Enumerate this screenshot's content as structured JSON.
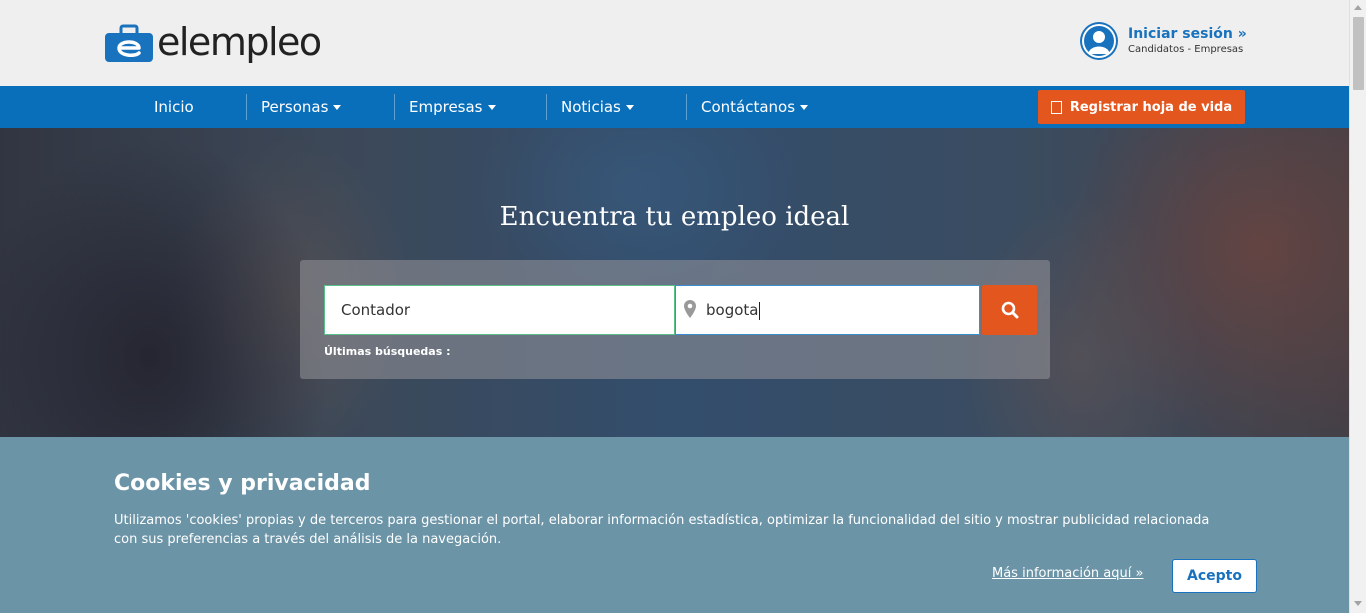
{
  "brand": {
    "name": "elempleo"
  },
  "login": {
    "title": "Iniciar sesión »",
    "subtitle": "Candidatos - Empresas"
  },
  "nav": {
    "items": [
      {
        "label": "Inicio"
      },
      {
        "label": "Personas"
      },
      {
        "label": "Empresas"
      },
      {
        "label": "Noticias"
      },
      {
        "label": "Contáctanos"
      }
    ],
    "register_label": "Registrar hoja de vida"
  },
  "hero": {
    "title": "Encuentra tu empleo ideal",
    "what_value": "Contador",
    "where_value": "bogota",
    "recent_label": "Últimas búsquedas :"
  },
  "cookies": {
    "title": "Cookies y privacidad",
    "text": "Utilizamos 'cookies' propias y de terceros para gestionar el portal, elaborar información estadística, optimizar la funcionalidad del sitio y mostrar publicidad relacionada con sus preferencias a través del análisis de la navegación.",
    "more_link": "Más información aquí »",
    "accept_label": "Acepto"
  },
  "colors": {
    "brand_blue": "#0a6fbb",
    "accent_orange": "#e3571f",
    "cookie_bg": "#6b94a7"
  },
  "icons": {
    "logo": "briefcase-e-logo-icon",
    "avatar": "user-avatar-icon",
    "register": "document-icon",
    "location": "map-pin-icon",
    "search": "search-icon"
  }
}
